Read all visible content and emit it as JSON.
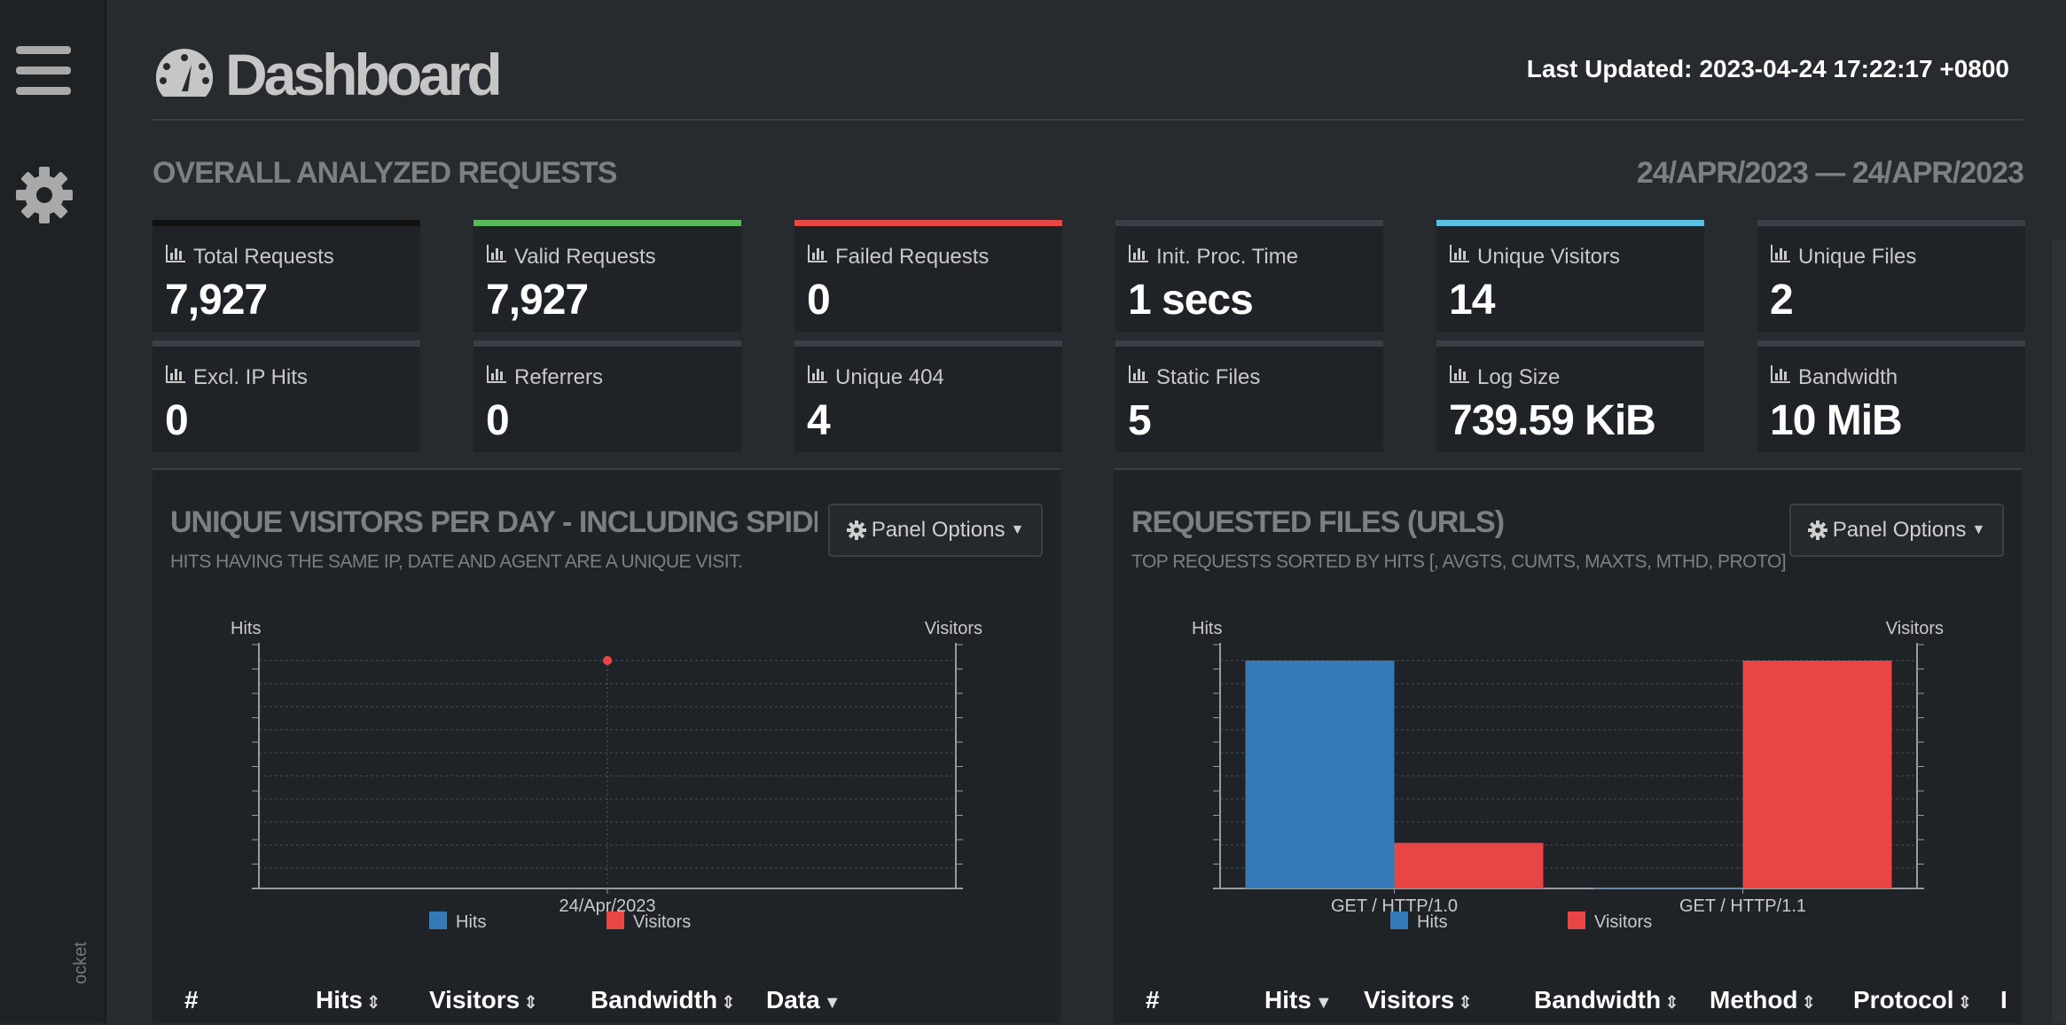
{
  "header": {
    "title": "Dashboard",
    "last_updated_label": "Last Updated:",
    "last_updated_value": "2023-04-24 17:22:17 +0800"
  },
  "sidebar": {
    "menu_icon": "hamburger-icon",
    "settings_icon": "gear-icon",
    "footer_text": "ocket"
  },
  "overall": {
    "title": "OVERALL ANALYZED REQUESTS",
    "range": "24/APR/2023 — 24/APR/2023",
    "cards": [
      {
        "label": "Total Requests",
        "value": "7,927",
        "accent": "#111111"
      },
      {
        "label": "Valid Requests",
        "value": "7,927",
        "accent": "#5cb85c"
      },
      {
        "label": "Failed Requests",
        "value": "0",
        "accent": "#e84545"
      },
      {
        "label": "Init. Proc. Time",
        "value": "1 secs",
        "accent": "#3b4046"
      },
      {
        "label": "Unique Visitors",
        "value": "14",
        "accent": "#5bc0de"
      },
      {
        "label": "Unique Files",
        "value": "2",
        "accent": "#3b4046"
      },
      {
        "label": "Excl. IP Hits",
        "value": "0",
        "accent": "#3b4046"
      },
      {
        "label": "Referrers",
        "value": "0",
        "accent": "#3b4046"
      },
      {
        "label": "Unique 404",
        "value": "4",
        "accent": "#3b4046"
      },
      {
        "label": "Static Files",
        "value": "5",
        "accent": "#3b4046"
      },
      {
        "label": "Log Size",
        "value": "739.59 KiB",
        "accent": "#3b4046"
      },
      {
        "label": "Bandwidth",
        "value": "10 MiB",
        "accent": "#3b4046"
      }
    ]
  },
  "panels": [
    {
      "title": "UNIQUE VISITORS PER DAY - INCLUDING SPIDERS",
      "subtitle": "HITS HAVING THE SAME IP, DATE AND AGENT ARE A UNIQUE VISIT.",
      "options_label": "Panel Options",
      "columns": [
        "#",
        "Hits",
        "Visitors",
        "Bandwidth",
        "Data"
      ]
    },
    {
      "title": "REQUESTED FILES (URLS)",
      "subtitle": "TOP REQUESTS SORTED BY HITS [, AVGTS, CUMTS, MAXTS, MTHD, PROTO]",
      "options_label": "Panel Options",
      "columns": [
        "#",
        "Hits",
        "Visitors",
        "Bandwidth",
        "Method",
        "Protocol",
        "I"
      ]
    }
  ],
  "chart_data": [
    {
      "type": "scatter",
      "categories": [
        "24/Apr/2023"
      ],
      "series": [
        {
          "name": "Hits",
          "values": [
            7927
          ]
        },
        {
          "name": "Visitors",
          "values": [
            14
          ]
        }
      ],
      "ylabel_left": "Hits",
      "ylabel_right": "Visitors",
      "legend": [
        "Hits",
        "Visitors"
      ],
      "colors": {
        "Hits": "#337ab7",
        "Visitors": "#e84545"
      },
      "grid": true,
      "legend_position": "bottom"
    },
    {
      "type": "bar",
      "categories": [
        "GET / HTTP/1.0",
        "GET / HTTP/1.1"
      ],
      "series": [
        {
          "name": "Hits",
          "values": [
            7400,
            15
          ]
        },
        {
          "name": "Visitors",
          "values": [
            2,
            10
          ]
        }
      ],
      "ylabel_left": "Hits",
      "ylabel_right": "Visitors",
      "legend": [
        "Hits",
        "Visitors"
      ],
      "colors": {
        "Hits": "#337ab7",
        "Visitors": "#e84545"
      },
      "grid": true,
      "legend_position": "bottom"
    }
  ]
}
